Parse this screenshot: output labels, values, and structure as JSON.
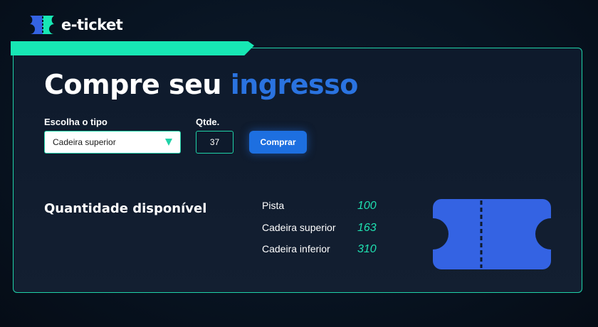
{
  "brand": {
    "name": "e-ticket"
  },
  "colors": {
    "accent_teal": "#1fd3a8",
    "accent_blue": "#2a73e0",
    "button_blue": "#1d6fe0",
    "ticket_blue": "#3463e3",
    "background": "#081422"
  },
  "purchase": {
    "title_prefix": "Compre seu",
    "title_accent": "ingresso",
    "type_label": "Escolha o tipo",
    "type_selected": "Cadeira superior",
    "qty_label": "Qtde.",
    "qty_value": "37",
    "buy_label": "Comprar"
  },
  "availability": {
    "title": "Quantidade disponível",
    "items": [
      {
        "name": "Pista",
        "count": "100"
      },
      {
        "name": "Cadeira superior",
        "count": "163"
      },
      {
        "name": "Cadeira inferior",
        "count": "310"
      }
    ]
  },
  "icons": {
    "logo": "ticket-logo-icon",
    "dropdown": "chevron-down-icon",
    "illustration": "ticket-illustration-icon"
  }
}
